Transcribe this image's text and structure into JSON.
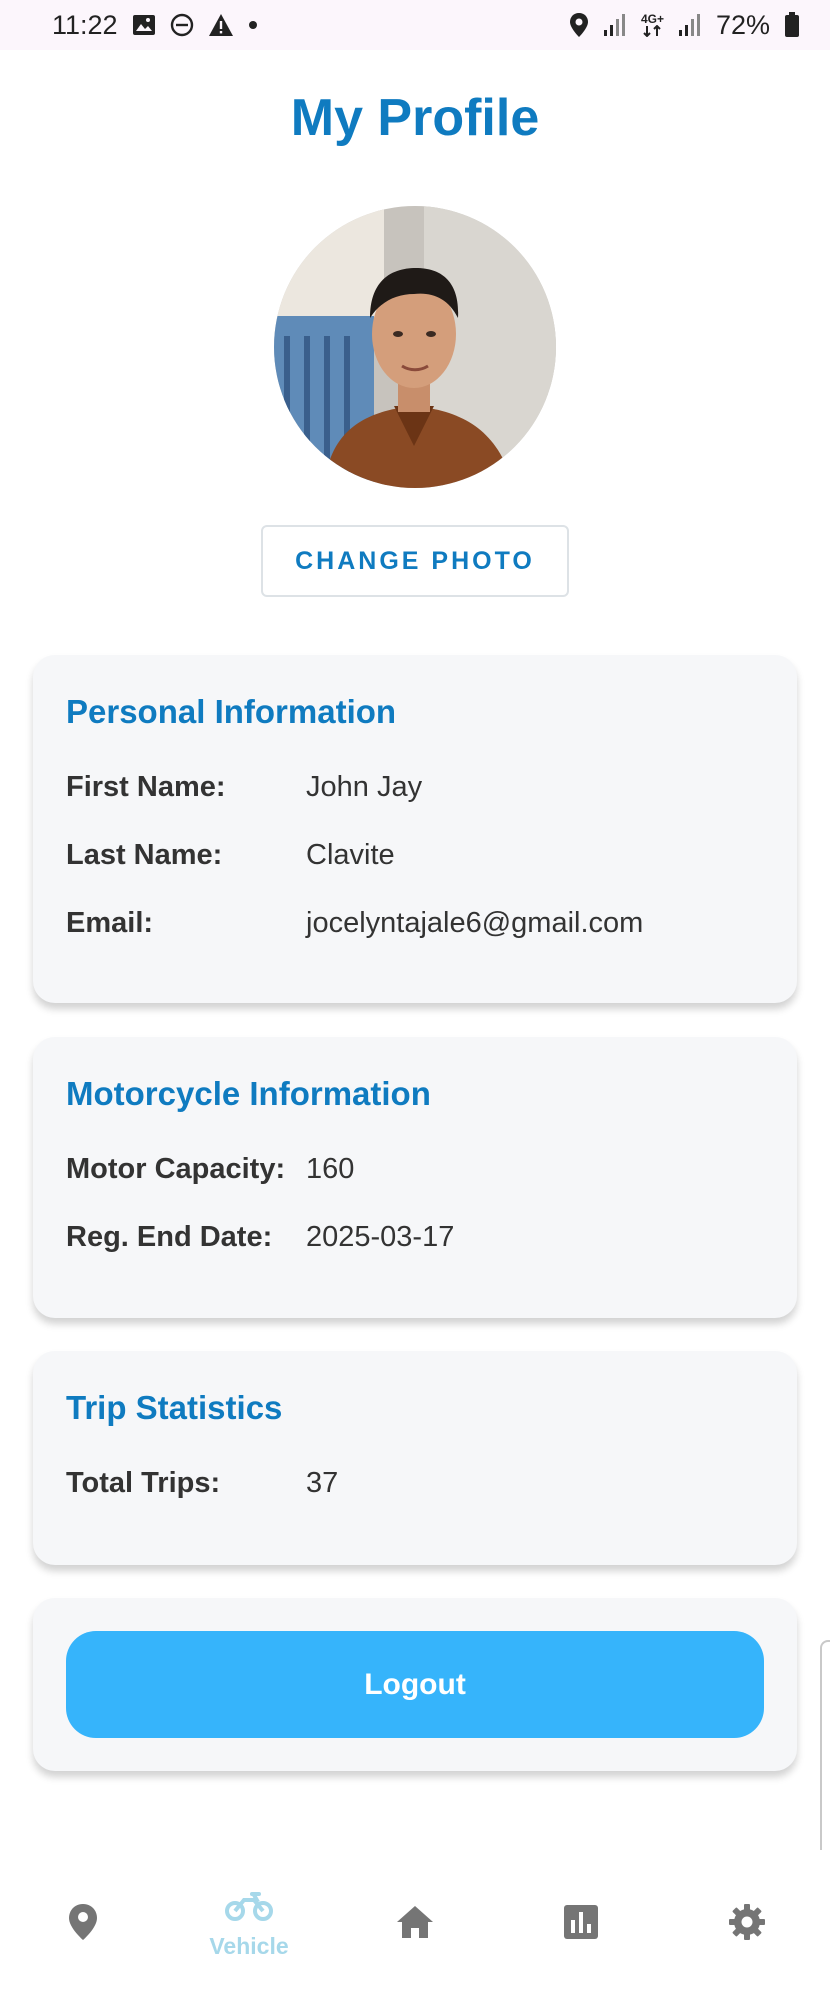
{
  "status_bar": {
    "time": "11:22",
    "left_icons": [
      "image-icon",
      "dnd-icon",
      "alert-icon",
      "dot-icon"
    ],
    "right_icons": [
      "location-icon",
      "signal-icon",
      "network-4g-icon",
      "signal-icon"
    ],
    "network_label": "4G+",
    "battery_percent": "72%"
  },
  "page": {
    "title": "My Profile"
  },
  "profile": {
    "photo_icon": "avatar-photo",
    "change_photo_label": "CHANGE PHOTO"
  },
  "personal": {
    "title": "Personal Information",
    "rows": [
      {
        "label": "First Name:",
        "value": "John Jay"
      },
      {
        "label": "Last Name:",
        "value": "Clavite"
      },
      {
        "label": "Email:",
        "value": "jocelyntajale6@gmail.com"
      }
    ]
  },
  "motorcycle": {
    "title": "Motorcycle Information",
    "rows": [
      {
        "label": "Motor Capacity:",
        "value": "160"
      },
      {
        "label": "Reg. End Date:",
        "value": "2025-03-17"
      }
    ]
  },
  "trips": {
    "title": "Trip Statistics",
    "rows": [
      {
        "label": "Total Trips:",
        "value": "37"
      }
    ]
  },
  "actions": {
    "logout_label": "Logout"
  },
  "bottom_nav": {
    "items": [
      {
        "icon": "location-pin-icon",
        "label": ""
      },
      {
        "icon": "motorcycle-icon",
        "label": "Vehicle"
      },
      {
        "icon": "home-icon",
        "label": ""
      },
      {
        "icon": "bar-chart-icon",
        "label": ""
      },
      {
        "icon": "gear-icon",
        "label": ""
      }
    ],
    "active_index": 1
  },
  "colors": {
    "accent": "#0f7bc0",
    "logout": "#36b4fb",
    "active_nav": "#a6d8ea",
    "inactive_nav": "#757575",
    "card_bg": "#f6f7f9"
  }
}
